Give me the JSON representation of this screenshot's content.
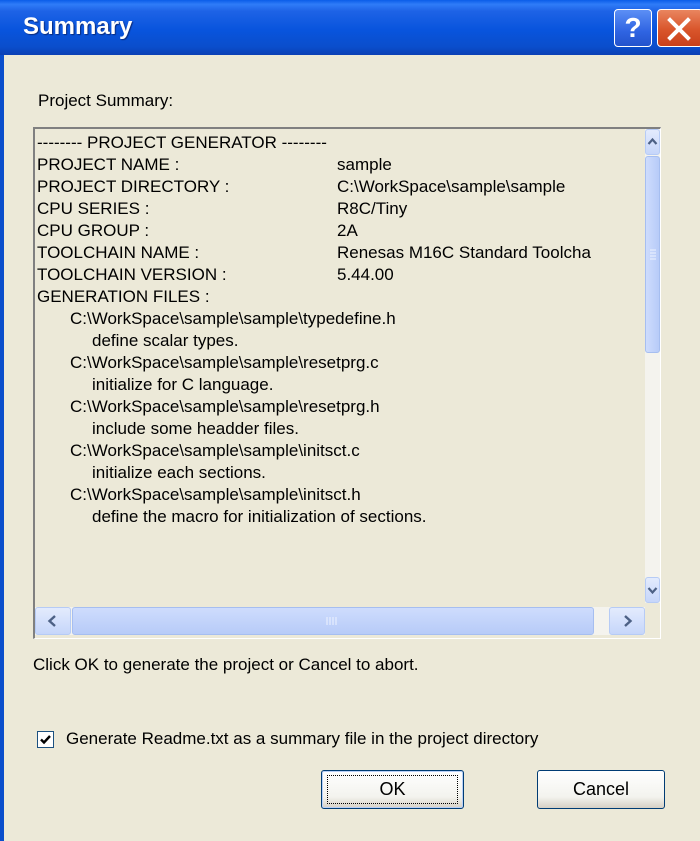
{
  "window": {
    "title": "Summary",
    "help_label": "?",
    "close_icon": "close-icon"
  },
  "project_summary_label": "Project Summary:",
  "summary": {
    "header": "-------- PROJECT GENERATOR --------",
    "rows": [
      {
        "key": "PROJECT NAME :",
        "value": "sample"
      },
      {
        "key": "PROJECT DIRECTORY :",
        "value": "C:\\WorkSpace\\sample\\sample"
      },
      {
        "key": "CPU SERIES :",
        "value": "R8C/Tiny"
      },
      {
        "key": "CPU GROUP :",
        "value": "2A"
      },
      {
        "key": "TOOLCHAIN NAME :",
        "value": "Renesas M16C Standard Toolcha"
      },
      {
        "key": "TOOLCHAIN VERSION :",
        "value": "5.44.00"
      }
    ],
    "files_label": "GENERATION FILES :",
    "files": [
      {
        "path": "C:\\WorkSpace\\sample\\sample\\typedefine.h",
        "desc": "define scalar types."
      },
      {
        "path": "C:\\WorkSpace\\sample\\sample\\resetprg.c",
        "desc": "initialize for C language."
      },
      {
        "path": "C:\\WorkSpace\\sample\\sample\\resetprg.h",
        "desc": "include some headder files."
      },
      {
        "path": "C:\\WorkSpace\\sample\\sample\\initsct.c",
        "desc": "initialize each sections."
      },
      {
        "path": "C:\\WorkSpace\\sample\\sample\\initsct.h",
        "desc": "define the macro for initialization of sections."
      }
    ]
  },
  "instruction": "Click OK to generate the project or Cancel to abort.",
  "readme_checkbox": {
    "label": "Generate Readme.txt as a summary file in the project directory",
    "checked": true
  },
  "buttons": {
    "ok": "OK",
    "cancel": "Cancel"
  },
  "colors": {
    "titlebar": "#0A4ECC",
    "dialog_bg": "#ECE9D8",
    "close_button": "#D9552B"
  }
}
